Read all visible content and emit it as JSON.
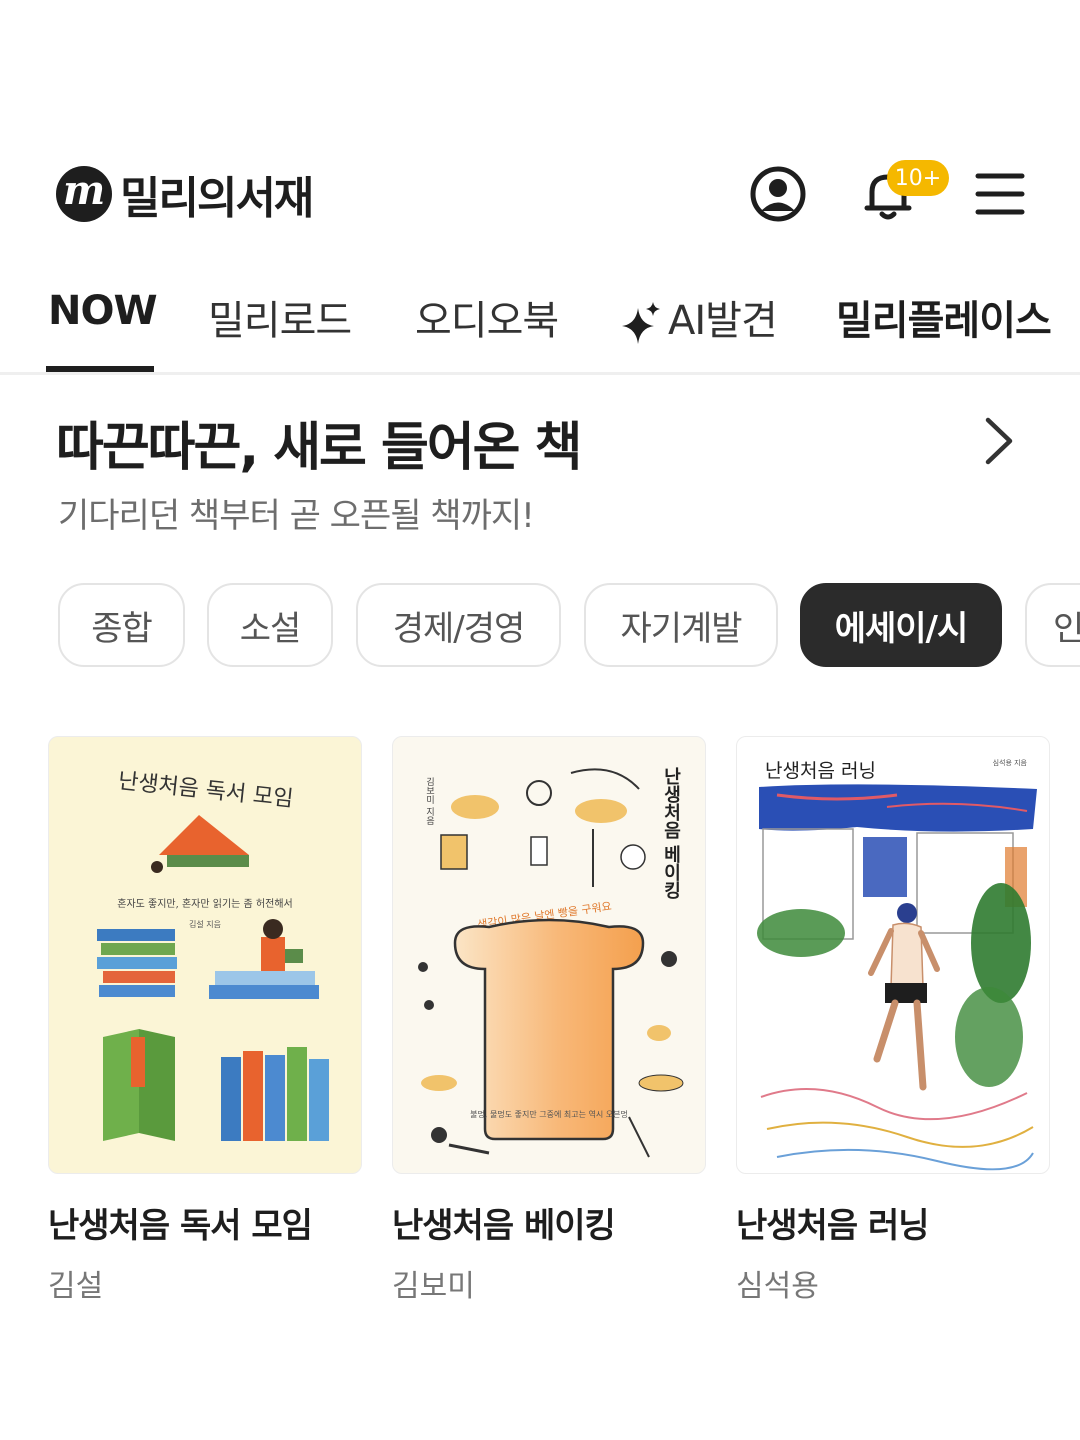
{
  "header": {
    "app_name": "밀리의서재",
    "logo_letter": "m",
    "notification_badge": "10+"
  },
  "tabs": [
    {
      "label": "NOW",
      "active": true
    },
    {
      "label": "밀리로드",
      "active": false
    },
    {
      "label": "오디오북",
      "active": false
    },
    {
      "label": "AI발견",
      "active": false
    },
    {
      "label": "밀리플레이스",
      "active": false
    }
  ],
  "section": {
    "title": "따끈따끈, 새로 들어온 책",
    "subtitle": "기다리던 책부터 곧 오픈될 책까지!"
  },
  "categories": [
    {
      "label": "종합",
      "active": false
    },
    {
      "label": "소설",
      "active": false
    },
    {
      "label": "경제/경영",
      "active": false
    },
    {
      "label": "자기계발",
      "active": false
    },
    {
      "label": "에세이/시",
      "active": true
    },
    {
      "label": "인",
      "active": false
    }
  ],
  "books": [
    {
      "title": "난생처음 독서 모임",
      "author": "김설",
      "cover_title": "난생처음 독서 모임",
      "cover_subtitle": "혼자도 좋지만, 혼자만 읽기는 좀 허전해서",
      "cover_author": "김설 지음",
      "cover_bg": "#fbf5d6"
    },
    {
      "title": "난생처음 베이킹",
      "author": "김보미",
      "cover_title": "난생처음 베이킹",
      "cover_tagline": "생각이 많은 날엔 빵을 구워요",
      "cover_bottom": "불멍, 물멍도 좋지만 그중에 최고는 역시 오븐멍",
      "cover_author": "김보미 지음",
      "cover_bg": "#fbf8ef"
    },
    {
      "title": "난생처음 러닝",
      "author": "심석용",
      "cover_title": "난생처음 러닝",
      "cover_author": "심석용 지음",
      "cover_bg": "#ffffff"
    }
  ],
  "colors": {
    "text_dark": "#1e1e1e",
    "badge": "#f5b800",
    "chip_active_bg": "#2b2b2b"
  }
}
